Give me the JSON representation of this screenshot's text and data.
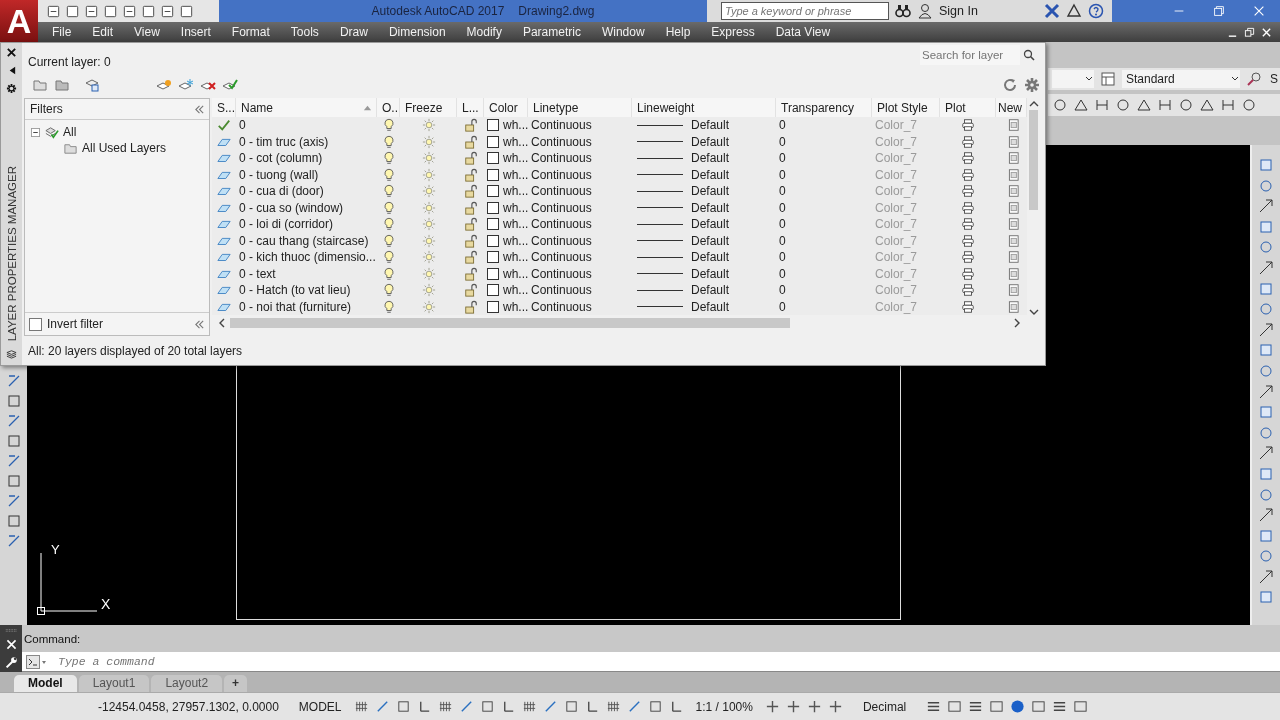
{
  "title_bar": {
    "logo": "A",
    "app_title": "Autodesk AutoCAD 2017",
    "file_name": "Drawing2.dwg",
    "search": {
      "placeholder": "Type a keyword or phrase"
    },
    "sign_in": "Sign In"
  },
  "menu_bar": [
    "File",
    "Edit",
    "View",
    "Insert",
    "Format",
    "Tools",
    "Draw",
    "Dimension",
    "Modify",
    "Parametric",
    "Window",
    "Help",
    "Express",
    "Data View"
  ],
  "toolbar": {
    "style_dropdown": "Standard",
    "cut_text": "S"
  },
  "layer_manager": {
    "palette_title": "LAYER PROPERTIES MANAGER",
    "current_layer": "Current layer: 0",
    "search": {
      "placeholder": "Search for layer"
    },
    "filters": {
      "header": "Filters",
      "tree": [
        {
          "label": "All",
          "expanded": true,
          "children": [
            {
              "label": "All Used Layers"
            }
          ]
        }
      ],
      "invert_filter": {
        "label": "Invert filter",
        "checked": false
      }
    },
    "columns": [
      "S...",
      "Name",
      "O...",
      "Freeze",
      "L...",
      "Color",
      "Linetype",
      "Lineweight",
      "Transparency",
      "Plot Style",
      "Plot",
      "New"
    ],
    "rows": [
      {
        "current": true,
        "name": "0",
        "on": true,
        "frozen": false,
        "locked": false,
        "color_name": "wh...",
        "linetype": "Continuous",
        "lineweight": "Default",
        "transparency": "0",
        "plot_style": "Color_7",
        "plot": true
      },
      {
        "current": false,
        "name": "0 - tim truc (axis)",
        "on": true,
        "frozen": false,
        "locked": false,
        "color_name": "wh...",
        "linetype": "Continuous",
        "lineweight": "Default",
        "transparency": "0",
        "plot_style": "Color_7",
        "plot": true
      },
      {
        "current": false,
        "name": "0 - cot (column)",
        "on": true,
        "frozen": false,
        "locked": false,
        "color_name": "wh...",
        "linetype": "Continuous",
        "lineweight": "Default",
        "transparency": "0",
        "plot_style": "Color_7",
        "plot": true
      },
      {
        "current": false,
        "name": "0 - tuong (wall)",
        "on": true,
        "frozen": false,
        "locked": false,
        "color_name": "wh...",
        "linetype": "Continuous",
        "lineweight": "Default",
        "transparency": "0",
        "plot_style": "Color_7",
        "plot": true
      },
      {
        "current": false,
        "name": "0 - cua di (door)",
        "on": true,
        "frozen": false,
        "locked": false,
        "color_name": "wh...",
        "linetype": "Continuous",
        "lineweight": "Default",
        "transparency": "0",
        "plot_style": "Color_7",
        "plot": true
      },
      {
        "current": false,
        "name": "0 - cua so (window)",
        "on": true,
        "frozen": false,
        "locked": false,
        "color_name": "wh...",
        "linetype": "Continuous",
        "lineweight": "Default",
        "transparency": "0",
        "plot_style": "Color_7",
        "plot": true
      },
      {
        "current": false,
        "name": "0 - loi di (corridor)",
        "on": true,
        "frozen": false,
        "locked": false,
        "color_name": "wh...",
        "linetype": "Continuous",
        "lineweight": "Default",
        "transparency": "0",
        "plot_style": "Color_7",
        "plot": true
      },
      {
        "current": false,
        "name": "0 - cau thang (staircase)",
        "on": true,
        "frozen": false,
        "locked": false,
        "color_name": "wh...",
        "linetype": "Continuous",
        "lineweight": "Default",
        "transparency": "0",
        "plot_style": "Color_7",
        "plot": true
      },
      {
        "current": false,
        "name": "0 - kich thuoc (dimensio...",
        "on": true,
        "frozen": false,
        "locked": false,
        "color_name": "wh...",
        "linetype": "Continuous",
        "lineweight": "Default",
        "transparency": "0",
        "plot_style": "Color_7",
        "plot": true
      },
      {
        "current": false,
        "name": "0 - text",
        "on": true,
        "frozen": false,
        "locked": false,
        "color_name": "wh...",
        "linetype": "Continuous",
        "lineweight": "Default",
        "transparency": "0",
        "plot_style": "Color_7",
        "plot": true
      },
      {
        "current": false,
        "name": "0 - Hatch (to vat lieu)",
        "on": true,
        "frozen": false,
        "locked": false,
        "color_name": "wh...",
        "linetype": "Continuous",
        "lineweight": "Default",
        "transparency": "0",
        "plot_style": "Color_7",
        "plot": true
      },
      {
        "current": false,
        "name": "0 - noi that (furniture)",
        "on": true,
        "frozen": false,
        "locked": false,
        "color_name": "wh...",
        "linetype": "Continuous",
        "lineweight": "Default",
        "transparency": "0",
        "plot_style": "Color_7",
        "plot": true
      }
    ],
    "summary": "All: 20 layers displayed of 20 total layers"
  },
  "drawing": {
    "ucs": {
      "y_label": "Y",
      "x_label": "X"
    }
  },
  "command_line": {
    "history": "Command:",
    "input": {
      "placeholder": "Type a command"
    }
  },
  "layout_tabs": [
    {
      "label": "Model",
      "selected": true
    },
    {
      "label": "Layout1",
      "selected": false
    },
    {
      "label": "Layout2",
      "selected": false
    }
  ],
  "add_tab": "+",
  "status_bar": {
    "coordinates": "-12454.0458, 27957.1302, 0.0000",
    "space": "MODEL",
    "scale": "1:1 / 100%",
    "units": "Decimal"
  }
}
